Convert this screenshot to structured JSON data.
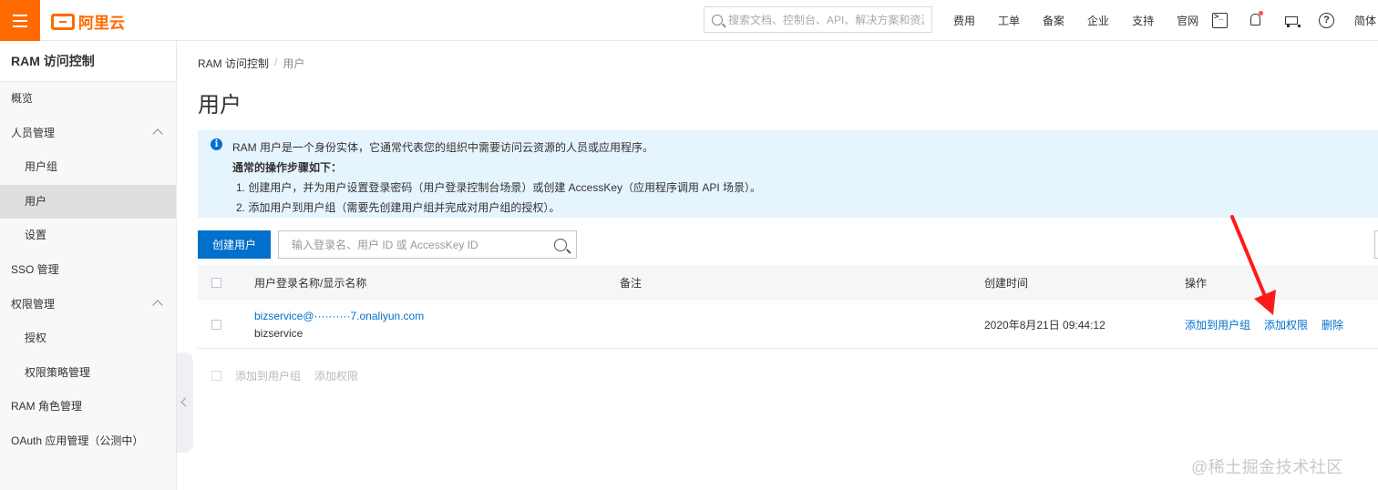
{
  "header": {
    "brand": "阿里云",
    "search_placeholder": "搜索文档、控制台、API、解决方案和资源",
    "nav": [
      "费用",
      "工单",
      "备案",
      "企业",
      "支持",
      "官网"
    ],
    "lang": "简体"
  },
  "sidebar": {
    "title": "RAM 访问控制",
    "items": [
      {
        "label": "概览"
      },
      {
        "label": "人员管理"
      },
      {
        "label": "用户组"
      },
      {
        "label": "用户"
      },
      {
        "label": "设置"
      },
      {
        "label": "SSO 管理"
      },
      {
        "label": "权限管理"
      },
      {
        "label": "授权"
      },
      {
        "label": "权限策略管理"
      },
      {
        "label": "RAM 角色管理"
      },
      {
        "label": "OAuth 应用管理（公测中）"
      }
    ]
  },
  "breadcrumb": {
    "root": "RAM 访问控制",
    "sep": "/",
    "current": "用户"
  },
  "page_title": "用户",
  "notice": {
    "line1": "RAM 用户是一个身份实体，它通常代表您的组织中需要访问云资源的人员或应用程序。",
    "line2": "通常的操作步骤如下：",
    "step1": "1.  创建用户，并为用户设置登录密码（用户登录控制台场景）或创建 AccessKey（应用程序调用 API 场景）。",
    "step2": "2.  添加用户到用户组（需要先创建用户组并完成对用户组的授权）。"
  },
  "toolbar": {
    "create_label": "创建用户",
    "search_placeholder": "输入登录名、用户 ID 或 AccessKey ID"
  },
  "table": {
    "headers": [
      "用户登录名称/显示名称",
      "备注",
      "创建时间",
      "操作"
    ],
    "rows": [
      {
        "login": "bizservice@··········7.onaliyun.com",
        "display": "bizservice",
        "note": "",
        "created": "2020年8月21日 09:44:12",
        "actions": [
          "添加到用户组",
          "添加权限",
          "删除"
        ]
      }
    ]
  },
  "batch": {
    "add_group": "添加到用户组",
    "add_perm": "添加权限"
  },
  "watermark": "@稀土掘金技术社区",
  "colors": {
    "accent": "#0070cc",
    "brand": "#ff6a00",
    "arrow": "#ff0000"
  }
}
